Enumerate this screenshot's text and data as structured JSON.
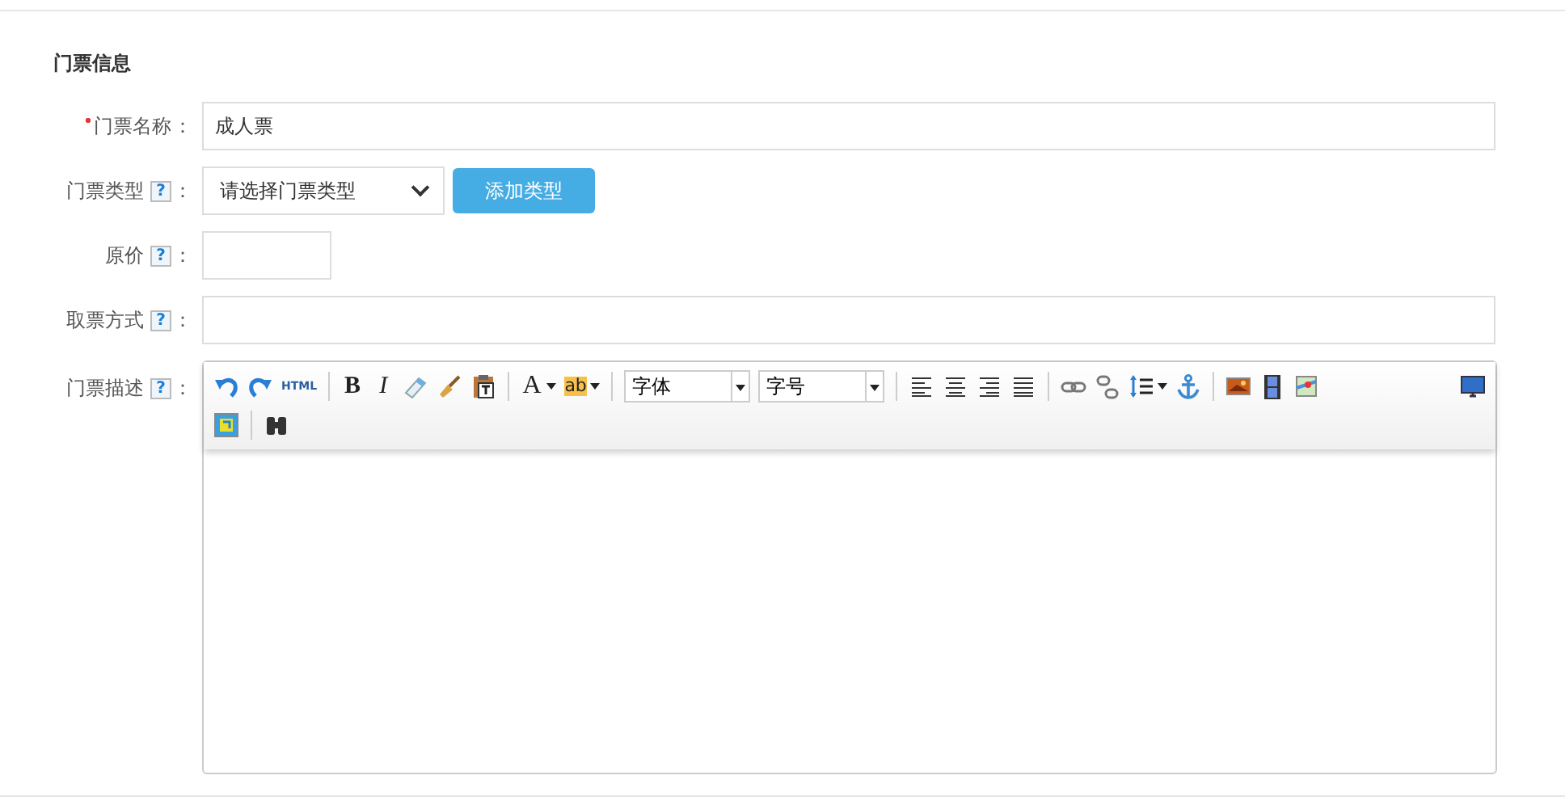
{
  "section_title": "门票信息",
  "fields": [
    {
      "kind": "text",
      "label": "门票名称",
      "required": true,
      "suffix": "：",
      "value": "成人票"
    },
    {
      "kind": "select",
      "label": "门票类型",
      "required": false,
      "help": "?",
      "suffix": "：",
      "value": "请选择门票类型",
      "button": "添加类型"
    },
    {
      "kind": "text",
      "label": "原价",
      "required": false,
      "help": "?",
      "suffix": "："
    },
    {
      "kind": "text",
      "label": "取票方式",
      "required": false,
      "help": "?",
      "suffix": "："
    },
    {
      "kind": "editor",
      "label": "门票描述",
      "required": false,
      "help": "?",
      "suffix": "："
    }
  ],
  "toolbar": [
    {
      "kind": "icon"
    },
    {
      "kind": "icon"
    },
    {
      "kind": "text",
      "label": "HTML"
    },
    {
      "kind": "separator"
    },
    {
      "kind": "text",
      "label": "B"
    },
    {
      "kind": "text",
      "label": "I"
    },
    {
      "kind": "icon"
    },
    {
      "kind": "icon"
    },
    {
      "kind": "icon"
    },
    {
      "kind": "separator"
    },
    {
      "kind": "text",
      "label": "A"
    },
    {
      "kind": "text",
      "label": "ab"
    },
    {
      "kind": "separator"
    },
    {
      "kind": "select",
      "value": "字体"
    },
    {
      "kind": "select",
      "value": "字号"
    },
    {
      "kind": "separator"
    },
    {
      "kind": "icon"
    },
    {
      "kind": "icon"
    },
    {
      "kind": "icon"
    },
    {
      "kind": "icon"
    },
    {
      "kind": "separator"
    },
    {
      "kind": "icon"
    },
    {
      "kind": "icon"
    },
    {
      "kind": "icon"
    },
    {
      "kind": "icon"
    },
    {
      "kind": "separator"
    },
    {
      "kind": "icon"
    },
    {
      "kind": "icon"
    },
    {
      "kind": "icon"
    },
    {
      "kind": "spacer"
    },
    {
      "kind": "icon"
    },
    {
      "kind": "break"
    },
    {
      "kind": "icon"
    },
    {
      "kind": "separator"
    },
    {
      "kind": "icon"
    }
  ]
}
